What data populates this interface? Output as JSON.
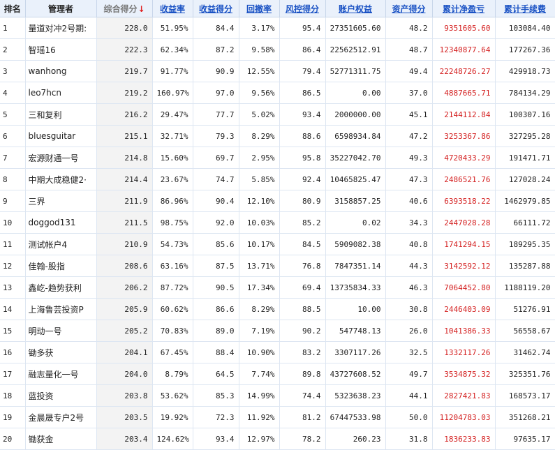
{
  "columns": [
    {
      "key": "rank",
      "label": "排名",
      "sortable": false
    },
    {
      "key": "manager",
      "label": "管理者",
      "sortable": false
    },
    {
      "key": "composite_score",
      "label": "综合得分",
      "sortable": true,
      "sorted": "desc",
      "sort_icon": "arrow-down-icon"
    },
    {
      "key": "return_rate",
      "label": "收益率",
      "sortable": true
    },
    {
      "key": "return_score",
      "label": "收益得分",
      "sortable": true
    },
    {
      "key": "drawdown",
      "label": "回撤率",
      "sortable": true
    },
    {
      "key": "risk_score",
      "label": "风控得分",
      "sortable": true
    },
    {
      "key": "equity",
      "label": "账户权益",
      "sortable": true
    },
    {
      "key": "asset_score",
      "label": "资产得分",
      "sortable": true
    },
    {
      "key": "net_profit",
      "label": "累计净盈亏",
      "sortable": true
    },
    {
      "key": "fees",
      "label": "累计手续费",
      "sortable": true
    }
  ],
  "sort_arrow_glyph": "↓",
  "colors": {
    "header_bg": "#eaf1fb",
    "header_link": "#1a52c4",
    "profit_text": "#d42020",
    "score_col_bg": "#f3f3f3",
    "grid_line": "#dde6f2"
  },
  "rows": [
    {
      "rank": "1",
      "manager": "量道对冲2号期:",
      "composite_score": "228.0",
      "return_rate": "51.95%",
      "return_score": "84.4",
      "drawdown": "3.17%",
      "risk_score": "95.4",
      "equity": "27351605.60",
      "asset_score": "48.2",
      "net_profit": "9351605.60",
      "fees": "103084.40"
    },
    {
      "rank": "2",
      "manager": "智瑶16",
      "composite_score": "222.3",
      "return_rate": "62.34%",
      "return_score": "87.2",
      "drawdown": "9.58%",
      "risk_score": "86.4",
      "equity": "22562512.91",
      "asset_score": "48.7",
      "net_profit": "12340877.64",
      "fees": "177267.36"
    },
    {
      "rank": "3",
      "manager": "wanhong",
      "composite_score": "219.7",
      "return_rate": "91.77%",
      "return_score": "90.9",
      "drawdown": "12.55%",
      "risk_score": "79.4",
      "equity": "52771311.75",
      "asset_score": "49.4",
      "net_profit": "22248726.27",
      "fees": "429918.73"
    },
    {
      "rank": "4",
      "manager": "leo7hcn",
      "composite_score": "219.2",
      "return_rate": "160.97%",
      "return_score": "97.0",
      "drawdown": "9.56%",
      "risk_score": "86.5",
      "equity": "0.00",
      "asset_score": "37.0",
      "net_profit": "4887665.71",
      "fees": "784134.29"
    },
    {
      "rank": "5",
      "manager": "三和复利",
      "composite_score": "216.2",
      "return_rate": "29.47%",
      "return_score": "77.7",
      "drawdown": "5.02%",
      "risk_score": "93.4",
      "equity": "2000000.00",
      "asset_score": "45.1",
      "net_profit": "2144112.84",
      "fees": "100307.16"
    },
    {
      "rank": "6",
      "manager": "bluesguitar",
      "composite_score": "215.1",
      "return_rate": "32.71%",
      "return_score": "79.3",
      "drawdown": "8.29%",
      "risk_score": "88.6",
      "equity": "6598934.84",
      "asset_score": "47.2",
      "net_profit": "3253367.86",
      "fees": "327295.28"
    },
    {
      "rank": "7",
      "manager": "宏源财通一号",
      "composite_score": "214.8",
      "return_rate": "15.60%",
      "return_score": "69.7",
      "drawdown": "2.95%",
      "risk_score": "95.8",
      "equity": "35227042.70",
      "asset_score": "49.3",
      "net_profit": "4720433.29",
      "fees": "191471.71"
    },
    {
      "rank": "8",
      "manager": "中期大成稳健2·",
      "composite_score": "214.4",
      "return_rate": "23.67%",
      "return_score": "74.7",
      "drawdown": "5.85%",
      "risk_score": "92.4",
      "equity": "10465825.47",
      "asset_score": "47.3",
      "net_profit": "2486521.76",
      "fees": "127028.24"
    },
    {
      "rank": "9",
      "manager": "三界",
      "composite_score": "211.9",
      "return_rate": "86.96%",
      "return_score": "90.4",
      "drawdown": "12.10%",
      "risk_score": "80.9",
      "equity": "3158857.25",
      "asset_score": "40.6",
      "net_profit": "6393518.22",
      "fees": "1462979.85"
    },
    {
      "rank": "10",
      "manager": "doggod131",
      "composite_score": "211.5",
      "return_rate": "98.75%",
      "return_score": "92.0",
      "drawdown": "10.03%",
      "risk_score": "85.2",
      "equity": "0.02",
      "asset_score": "34.3",
      "net_profit": "2447028.28",
      "fees": "66111.72"
    },
    {
      "rank": "11",
      "manager": "测试帐户4",
      "composite_score": "210.9",
      "return_rate": "54.73%",
      "return_score": "85.6",
      "drawdown": "10.17%",
      "risk_score": "84.5",
      "equity": "5909082.38",
      "asset_score": "40.8",
      "net_profit": "1741294.15",
      "fees": "189295.35"
    },
    {
      "rank": "12",
      "manager": "佳翰-股指",
      "composite_score": "208.6",
      "return_rate": "63.16%",
      "return_score": "87.5",
      "drawdown": "13.71%",
      "risk_score": "76.8",
      "equity": "7847351.14",
      "asset_score": "44.3",
      "net_profit": "3142592.12",
      "fees": "135287.88"
    },
    {
      "rank": "13",
      "manager": "鑫屹-趋势获利",
      "composite_score": "206.2",
      "return_rate": "87.72%",
      "return_score": "90.5",
      "drawdown": "17.34%",
      "risk_score": "69.4",
      "equity": "13735834.33",
      "asset_score": "46.3",
      "net_profit": "7064452.80",
      "fees": "1188119.20"
    },
    {
      "rank": "14",
      "manager": "上海鲁芸投资P",
      "composite_score": "205.9",
      "return_rate": "60.62%",
      "return_score": "86.6",
      "drawdown": "8.29%",
      "risk_score": "88.5",
      "equity": "10.00",
      "asset_score": "30.8",
      "net_profit": "2446403.09",
      "fees": "51276.91"
    },
    {
      "rank": "15",
      "manager": "明动一号",
      "composite_score": "205.2",
      "return_rate": "70.83%",
      "return_score": "89.0",
      "drawdown": "7.19%",
      "risk_score": "90.2",
      "equity": "547748.13",
      "asset_score": "26.0",
      "net_profit": "1041386.33",
      "fees": "56558.67"
    },
    {
      "rank": "16",
      "manager": "锄多获",
      "composite_score": "204.1",
      "return_rate": "67.45%",
      "return_score": "88.4",
      "drawdown": "10.90%",
      "risk_score": "83.2",
      "equity": "3307117.26",
      "asset_score": "32.5",
      "net_profit": "1332117.26",
      "fees": "31462.74"
    },
    {
      "rank": "17",
      "manager": "融志量化一号",
      "composite_score": "204.0",
      "return_rate": "8.79%",
      "return_score": "64.5",
      "drawdown": "7.74%",
      "risk_score": "89.8",
      "equity": "43727608.52",
      "asset_score": "49.7",
      "net_profit": "3534875.32",
      "fees": "325351.76"
    },
    {
      "rank": "18",
      "manager": "蓝投资",
      "composite_score": "203.8",
      "return_rate": "53.62%",
      "return_score": "85.3",
      "drawdown": "14.99%",
      "risk_score": "74.4",
      "equity": "5323638.23",
      "asset_score": "44.1",
      "net_profit": "2827421.83",
      "fees": "168573.17"
    },
    {
      "rank": "19",
      "manager": "金晨晟专户2号",
      "composite_score": "203.5",
      "return_rate": "19.92%",
      "return_score": "72.3",
      "drawdown": "11.92%",
      "risk_score": "81.2",
      "equity": "67447533.98",
      "asset_score": "50.0",
      "net_profit": "11204783.03",
      "fees": "351268.21"
    },
    {
      "rank": "20",
      "manager": "锄获金",
      "composite_score": "203.4",
      "return_rate": "124.62%",
      "return_score": "93.4",
      "drawdown": "12.97%",
      "risk_score": "78.2",
      "equity": "260.23",
      "asset_score": "31.8",
      "net_profit": "1836233.83",
      "fees": "97635.17"
    }
  ]
}
